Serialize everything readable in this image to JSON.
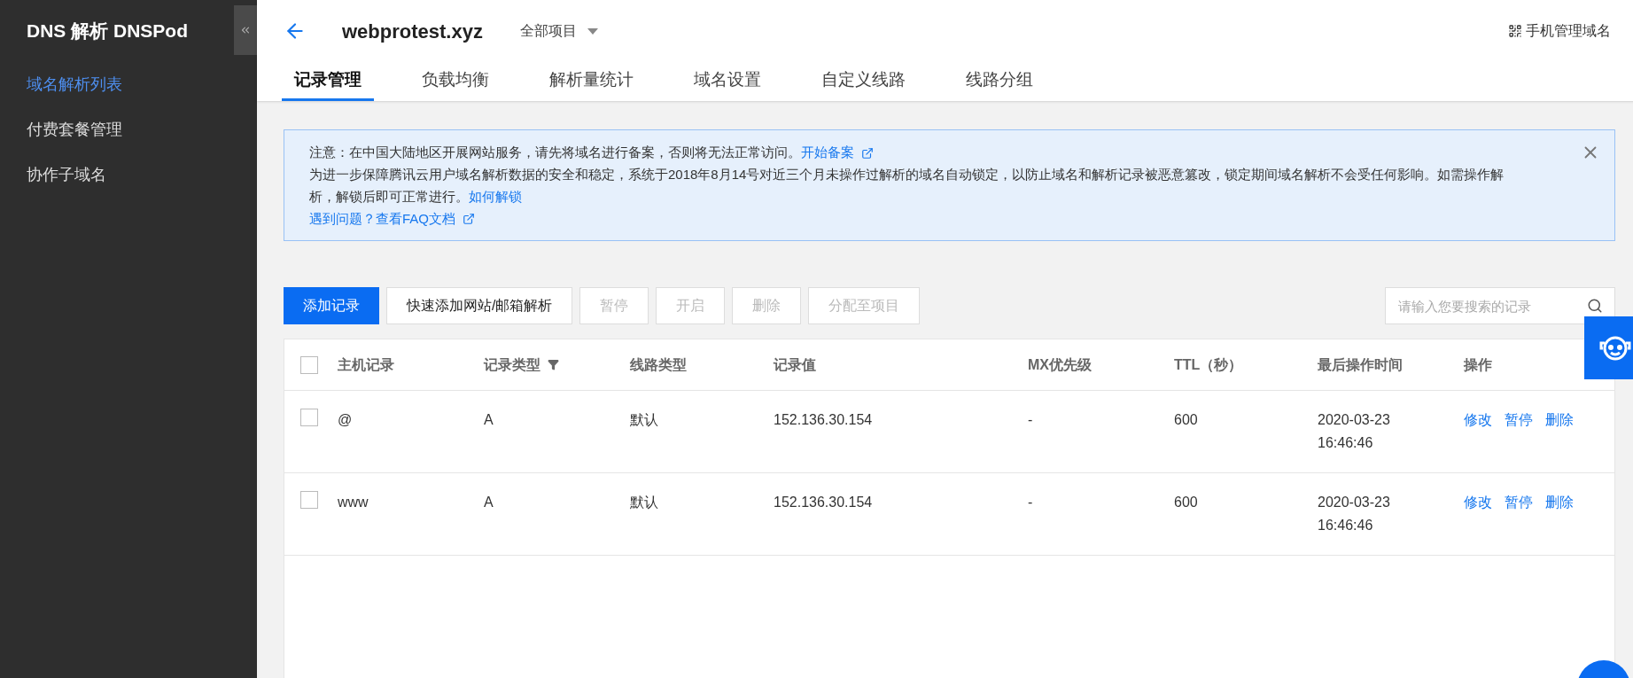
{
  "sidebar": {
    "title": "DNS 解析 DNSPod",
    "items": [
      {
        "label": "域名解析列表",
        "selected": true
      },
      {
        "label": "付费套餐管理",
        "selected": false
      },
      {
        "label": "协作子域名",
        "selected": false
      }
    ]
  },
  "header": {
    "domain": "webprotest.xyz",
    "project": "全部项目",
    "mobile_link": "手机管理域名"
  },
  "tabs": [
    {
      "label": "记录管理",
      "selected": true
    },
    {
      "label": "负载均衡",
      "selected": false
    },
    {
      "label": "解析量统计",
      "selected": false
    },
    {
      "label": "域名设置",
      "selected": false
    },
    {
      "label": "自定义线路",
      "selected": false
    },
    {
      "label": "线路分组",
      "selected": false
    }
  ],
  "notice": {
    "line1": "注意：在中国大陆地区开展网站服务，请先将域名进行备案，否则将无法正常访问。",
    "line1_link": "开始备案",
    "line2": "为进一步保障腾讯云用户域名解析数据的安全和稳定，系统于2018年8月14号对近三个月未操作过解析的域名自动锁定，以防止域名和解析记录被恶意篡改，锁定期间域名解析不会受任何影响。如需操作解析，解锁后即可正常进行。",
    "line2_link": "如何解锁",
    "line3_link": "遇到问题？查看FAQ文档"
  },
  "toolbar": {
    "buttons": [
      {
        "label": "添加记录",
        "kind": "primary",
        "disabled": false
      },
      {
        "label": "快速添加网站/邮箱解析",
        "kind": "default",
        "disabled": false
      },
      {
        "label": "暂停",
        "kind": "default",
        "disabled": true
      },
      {
        "label": "开启",
        "kind": "default",
        "disabled": true
      },
      {
        "label": "删除",
        "kind": "default",
        "disabled": true
      },
      {
        "label": "分配至项目",
        "kind": "default",
        "disabled": true
      }
    ],
    "search": {
      "placeholder": "请输入您要搜索的记录"
    }
  },
  "table": {
    "select_all_checked": false,
    "columns": [
      "主机记录",
      "记录类型",
      "线路类型",
      "记录值",
      "MX优先级",
      "TTL（秒）",
      "最后操作时间",
      "操作"
    ],
    "rows": [
      {
        "checked": false,
        "cells": [
          "@",
          "A",
          "默认",
          "152.136.30.154",
          "-",
          "600",
          "2020-03-23 16:46:46"
        ],
        "actions": [
          "修改",
          "暂停",
          "删除"
        ]
      },
      {
        "checked": false,
        "cells": [
          "www",
          "A",
          "默认",
          "152.136.30.154",
          "-",
          "600",
          "2020-03-23 16:46:46"
        ],
        "actions": [
          "修改",
          "暂停",
          "删除"
        ]
      }
    ]
  }
}
